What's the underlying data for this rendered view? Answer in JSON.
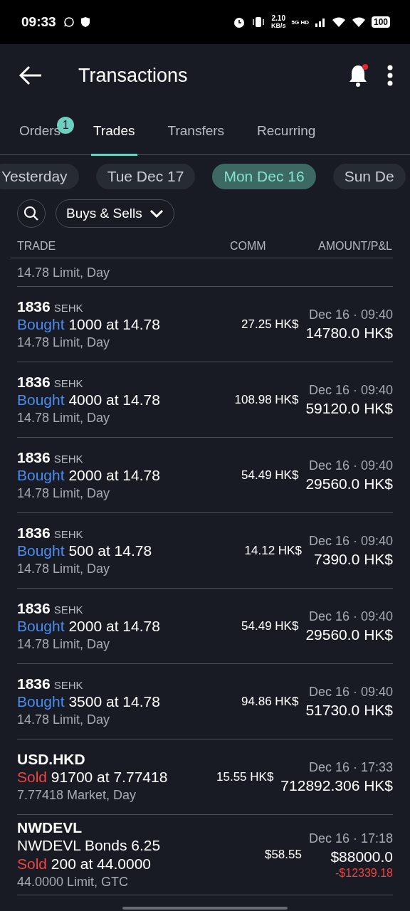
{
  "status_bar": {
    "time": "09:33",
    "speed": "2.10",
    "speed_unit": "KB/s",
    "network": "5G HD",
    "battery": "100"
  },
  "header": {
    "title": "Transactions",
    "notification": true
  },
  "tabs": [
    {
      "label": "Orders",
      "badge": "1",
      "selected": false
    },
    {
      "label": "Trades",
      "selected": true
    },
    {
      "label": "Transfers",
      "selected": false
    },
    {
      "label": "Recurring",
      "selected": false
    }
  ],
  "date_chips": [
    {
      "label": "Yesterday",
      "selected": false
    },
    {
      "label": "Tue Dec 17",
      "selected": false
    },
    {
      "label": "Mon Dec 16",
      "selected": true
    },
    {
      "label": "Sun De",
      "selected": false
    }
  ],
  "filter": {
    "label": "Buys & Sells"
  },
  "columns": [
    "TRADE",
    "COMM",
    "AMOUNT/P&L"
  ],
  "partial_row": {
    "order": "14.78 Limit, Day"
  },
  "trades": [
    {
      "symbol": "1836",
      "exchange": "SEHK",
      "side": "Bought",
      "kind": "buy",
      "detail": "1000 at 14.78",
      "order": "14.78 Limit, Day",
      "comm": "27.25 HK$",
      "date": "Dec 16 · 09:40",
      "amount": "14780.0 HK$"
    },
    {
      "symbol": "1836",
      "exchange": "SEHK",
      "side": "Bought",
      "kind": "buy",
      "detail": "4000 at 14.78",
      "order": "14.78 Limit, Day",
      "comm": "108.98 HK$",
      "date": "Dec 16 · 09:40",
      "amount": "59120.0 HK$"
    },
    {
      "symbol": "1836",
      "exchange": "SEHK",
      "side": "Bought",
      "kind": "buy",
      "detail": "2000 at 14.78",
      "order": "14.78 Limit, Day",
      "comm": "54.49 HK$",
      "date": "Dec 16 · 09:40",
      "amount": "29560.0 HK$"
    },
    {
      "symbol": "1836",
      "exchange": "SEHK",
      "side": "Bought",
      "kind": "buy",
      "detail": "500 at 14.78",
      "order": "14.78 Limit, Day",
      "comm": "14.12 HK$",
      "date": "Dec 16 · 09:40",
      "amount": "7390.0 HK$"
    },
    {
      "symbol": "1836",
      "exchange": "SEHK",
      "side": "Bought",
      "kind": "buy",
      "detail": "2000 at 14.78",
      "order": "14.78 Limit, Day",
      "comm": "54.49 HK$",
      "date": "Dec 16 · 09:40",
      "amount": "29560.0 HK$"
    },
    {
      "symbol": "1836",
      "exchange": "SEHK",
      "side": "Bought",
      "kind": "buy",
      "detail": "3500 at 14.78",
      "order": "14.78 Limit, Day",
      "comm": "94.86 HK$",
      "date": "Dec 16 · 09:40",
      "amount": "51730.0 HK$"
    },
    {
      "symbol": "USD.HKD",
      "side": "Sold",
      "kind": "sell",
      "detail": "91700 at 7.77418",
      "order": "7.77418 Market, Day",
      "comm": "15.55 HK$",
      "date": "Dec 16 · 17:33",
      "amount": "712892.306 HK$"
    },
    {
      "symbol": "NWDEVL",
      "description": "NWDEVL Bonds 6.25",
      "side": "Sold",
      "kind": "sell",
      "detail": "200 at 44.0000",
      "order": "44.0000 Limit, GTC",
      "comm": "$58.55",
      "date": "Dec 16 · 17:18",
      "amount": "$88000.0",
      "pnl": "-$12339.18"
    }
  ]
}
